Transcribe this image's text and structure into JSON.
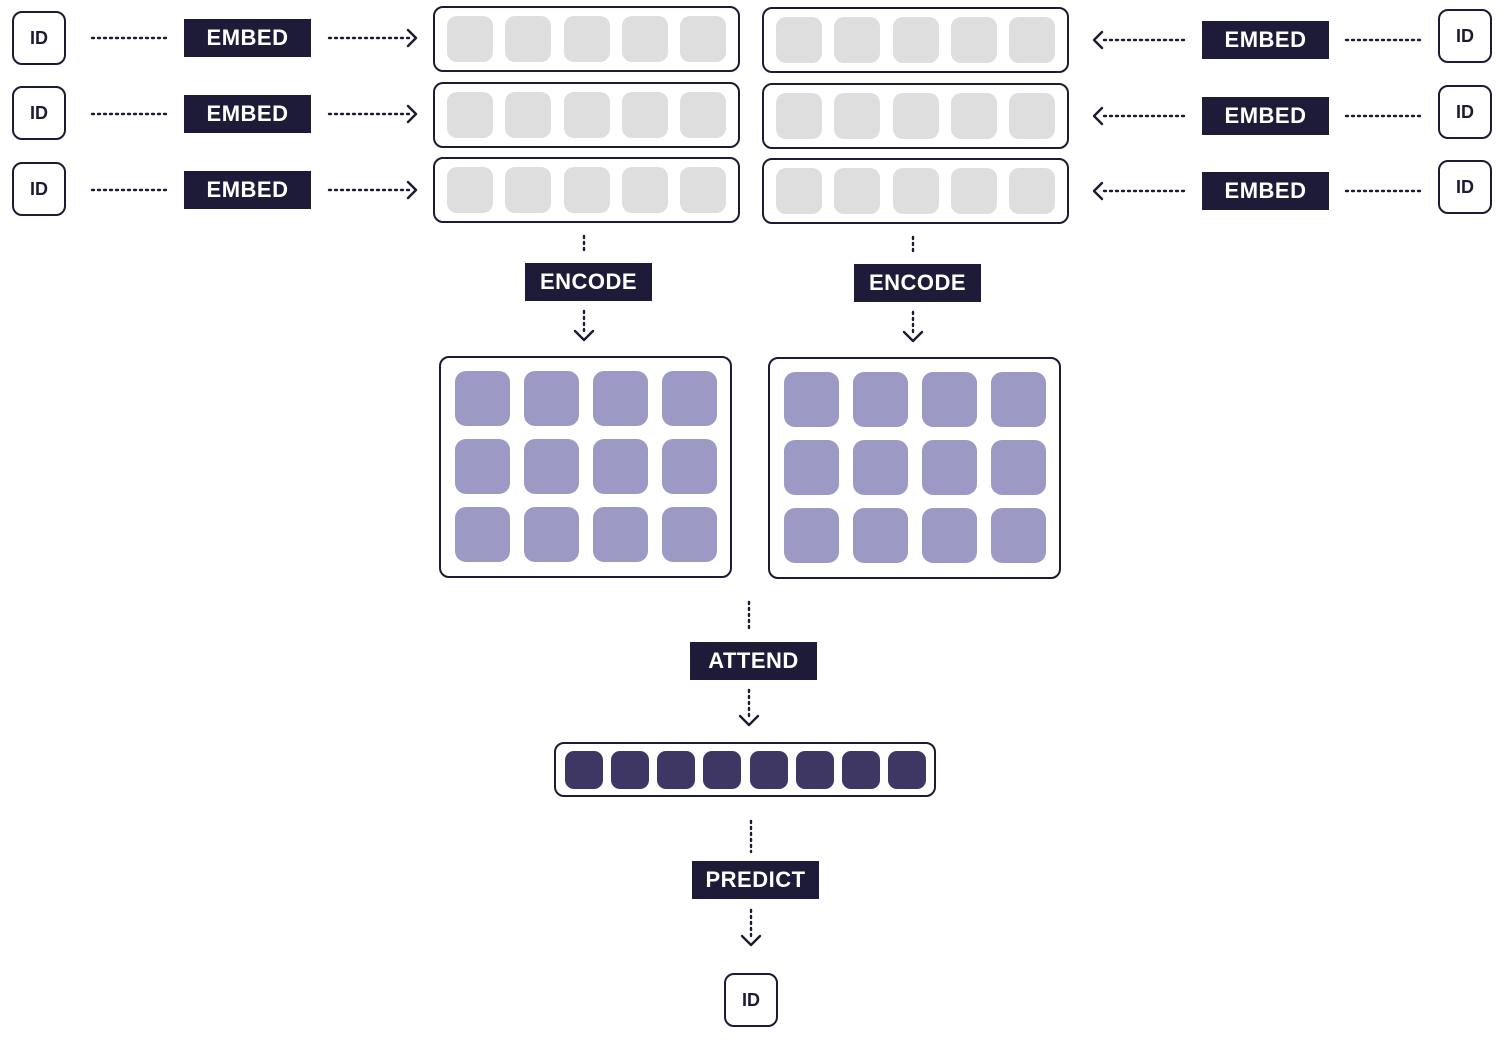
{
  "labels": {
    "id": "ID",
    "embed": "EMBED",
    "encode": "ENCODE",
    "attend": "ATTEND",
    "predict": "PREDICT"
  },
  "colors": {
    "ink": "#1e1b38",
    "input_cell": "#dedede",
    "encoded_cell": "#9c9ac4",
    "attended_cell": "#3e3663"
  }
}
